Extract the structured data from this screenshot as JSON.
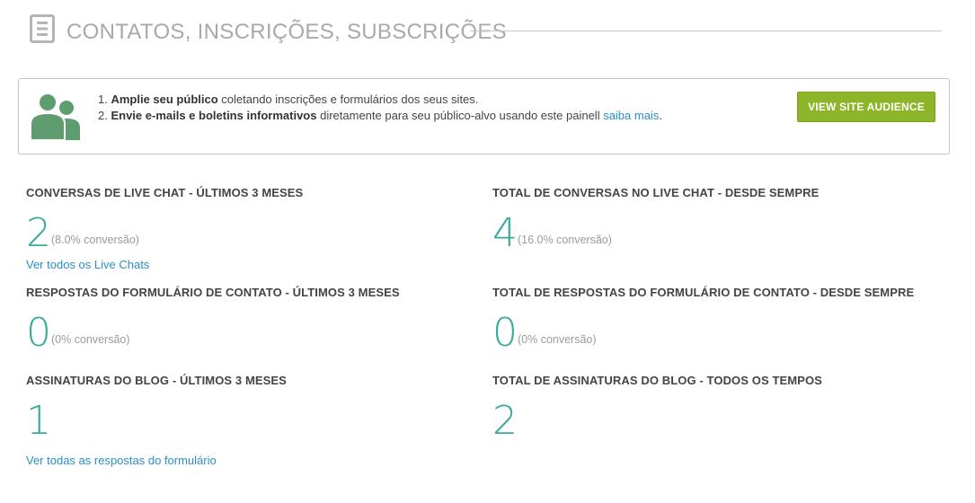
{
  "header": {
    "title": "CONTATOS, INSCRIÇÕES, SUBSCRIÇÕES",
    "icon": "document-icon"
  },
  "info": {
    "line1_num": "1.",
    "line1_bold": "Amplie seu público",
    "line1_rest": " coletando inscrições e formulários dos seus sites.",
    "line2_num": "2.",
    "line2_bold": "Envie e-mails e boletins informativos",
    "line2_rest": " diretamente para seu público-alvo usando este painell ",
    "line2_link": "saiba mais",
    "line2_end": ".",
    "button_label": "VIEW SITE AUDIENCE",
    "button_color": "#8db52a",
    "icon": "users-icon"
  },
  "stats": [
    {
      "title": "CONVERSAS DE LIVE CHAT - ÚLTIMOS 3 MESES",
      "value": "2",
      "conversion": "(8.0% conversão)",
      "link": "Ver todos os Live Chats"
    },
    {
      "title": "TOTAL DE CONVERSAS NO LIVE CHAT - DESDE SEMPRE",
      "value": "4",
      "conversion": "(16.0% conversão)"
    },
    {
      "title": "RESPOSTAS DO FORMULÁRIO DE CONTATO - ÚLTIMOS 3 MESES",
      "value": "0",
      "conversion": "(0% conversão)"
    },
    {
      "title": "TOTAL DE RESPOSTAS DO FORMULÁRIO DE CONTATO - DESDE SEMPRE",
      "value": "0",
      "conversion": "(0% conversão)"
    },
    {
      "title": "ASSINATURAS DO BLOG - ÚLTIMOS 3 MESES",
      "value": "1",
      "link": "Ver todas as respostas do formulário"
    },
    {
      "title": "TOTAL DE ASSINATURAS DO BLOG - TODOS OS TEMPOS",
      "value": "2"
    }
  ],
  "colors": {
    "accent_number": "#3aaa9a",
    "link": "#2a8fc6",
    "icon_green": "#5e9e6e"
  }
}
